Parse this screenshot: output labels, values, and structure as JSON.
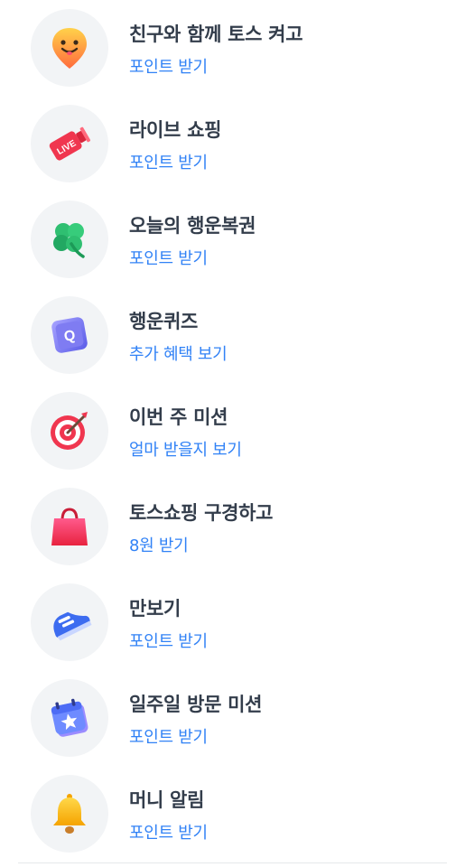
{
  "benefits": {
    "items": [
      {
        "title": "친구와 함께 토스 켜고",
        "subtitle": "포인트 받기",
        "icon": "smiley-pin-icon"
      },
      {
        "title": "라이브 쇼핑",
        "subtitle": "포인트 받기",
        "icon": "live-icon",
        "icon_text": "LIVE"
      },
      {
        "title": "오늘의 행운복권",
        "subtitle": "포인트 받기",
        "icon": "clover-icon"
      },
      {
        "title": "행운퀴즈",
        "subtitle": "추가 혜택 보기",
        "icon": "quiz-icon",
        "icon_text": "Q"
      },
      {
        "title": "이번 주 미션",
        "subtitle": "얼마 받을지 보기",
        "icon": "target-icon"
      },
      {
        "title": "토스쇼핑 구경하고",
        "subtitle": "8원 받기",
        "icon": "shopping-bag-icon"
      },
      {
        "title": "만보기",
        "subtitle": "포인트 받기",
        "icon": "sneaker-icon"
      },
      {
        "title": "일주일 방문 미션",
        "subtitle": "포인트 받기",
        "icon": "calendar-icon"
      },
      {
        "title": "머니 알림",
        "subtitle": "포인트 받기",
        "icon": "bell-icon"
      }
    ]
  },
  "colors": {
    "title": "#333d4b",
    "subtitle": "#3182f6",
    "icon_bg": "#f2f4f6"
  }
}
